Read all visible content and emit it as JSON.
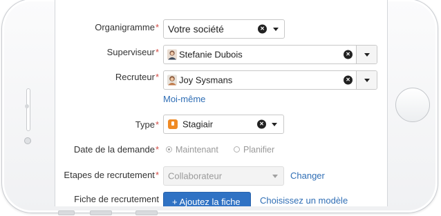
{
  "form": {
    "organigramme": {
      "label": "Organigramme",
      "required": "*",
      "value": "Votre société"
    },
    "superviseur": {
      "label": "Superviseur",
      "required": "*",
      "value": "Stefanie Dubois"
    },
    "recruteur": {
      "label": "Recruteur",
      "required": "*",
      "value": "Joy Sysmans",
      "self_link": "Moi-même"
    },
    "type": {
      "label": "Type",
      "required": "*",
      "value": "Stagiair",
      "icon": "badge-icon"
    },
    "date_demande": {
      "label": "Date de la demande",
      "required": "*",
      "option_now": "Maintenant",
      "option_plan": "Planifier",
      "selected": "Maintenant"
    },
    "etapes": {
      "label": "Etapes de recrutement",
      "required": "*",
      "value": "Collaborateur",
      "change_link": "Changer"
    },
    "fiche": {
      "label": "Fiche de recrutement",
      "button": "+ Ajoutez la fiche",
      "template_link": "Choisissez un modèle"
    }
  },
  "icons": {
    "clear": "close-circle-icon",
    "dropdown": "chevron-down-icon"
  },
  "colors": {
    "link": "#2f6eb5",
    "required": "#d24a43",
    "primary": "#2f72c4",
    "type_icon": "#f08a24"
  }
}
